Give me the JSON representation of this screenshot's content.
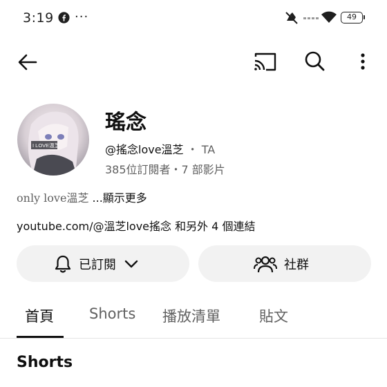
{
  "status_bar": {
    "time": "3:19",
    "more": "···",
    "battery_level": "49",
    "icons": [
      "facebook-icon",
      "mute-icon",
      "signal-dots",
      "wifi-icon",
      "battery-icon"
    ]
  },
  "app_bar": {
    "icons": [
      "back-arrow-icon",
      "cast-icon",
      "search-icon",
      "more-vert-icon"
    ]
  },
  "channel": {
    "name": "瑤念",
    "handle": "@搖念love溫芝",
    "separator": "・",
    "badge": "TA",
    "stats": "385位訂閱者・7 部影片",
    "description": "only love溫芝",
    "description_more": " ...顯示更多",
    "links": "youtube.com/@溫芝love搖念 和另外 4 個連結",
    "avatar_overlay_text": "I LOVE溫芝"
  },
  "actions": {
    "subscribe_label": "已訂閱",
    "community_label": "社群"
  },
  "tabs": [
    {
      "label": "首頁",
      "active": true
    },
    {
      "label": "Shorts",
      "active": false
    },
    {
      "label": "播放清單",
      "active": false
    },
    {
      "label": "貼文",
      "active": false
    }
  ],
  "section": {
    "heading": "Shorts"
  },
  "colors": {
    "text_primary": "#0f0f0f",
    "text_secondary": "#606060",
    "pill_bg": "#f2f2f2"
  }
}
